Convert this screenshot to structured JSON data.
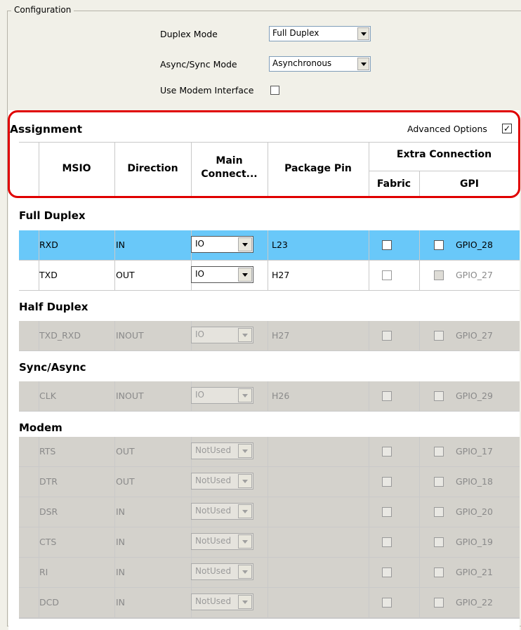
{
  "configuration": {
    "title": "Configuration",
    "duplex_mode": {
      "label": "Duplex Mode",
      "value": "Full Duplex"
    },
    "async_sync_mode": {
      "label": "Async/Sync Mode",
      "value": "Asynchronous"
    },
    "use_modem_interface": {
      "label": "Use Modem Interface",
      "checked": false
    }
  },
  "assignment": {
    "title": "Assignment",
    "advanced_options": {
      "label": "Advanced Options",
      "checked": true,
      "mark": "✓"
    },
    "columns": {
      "msio": "MSIO",
      "direction": "Direction",
      "main_connect_line1": "Main",
      "main_connect_line2": "Connect...",
      "package_pin": "Package Pin",
      "extra_connection": "Extra Connection",
      "fabric": "Fabric",
      "gpi": "GPI"
    },
    "groups": {
      "full_duplex": "Full Duplex",
      "half_duplex": "Half Duplex",
      "sync_async": "Sync/Async",
      "modem": "Modem"
    },
    "rows": [
      {
        "msio": "RXD",
        "direction": "IN",
        "main": "IO",
        "pin": "L23",
        "gpio": "GPIO_28",
        "state": "selected"
      },
      {
        "msio": "TXD",
        "direction": "OUT",
        "main": "IO",
        "pin": "H27",
        "gpio": "GPIO_27",
        "state": "normal"
      },
      {
        "msio": "TXD_RXD",
        "direction": "INOUT",
        "main": "IO",
        "pin": "H27",
        "gpio": "GPIO_27",
        "state": "disabled"
      },
      {
        "msio": "CLK",
        "direction": "INOUT",
        "main": "IO",
        "pin": "H26",
        "gpio": "GPIO_29",
        "state": "disabled"
      },
      {
        "msio": "RTS",
        "direction": "OUT",
        "main": "NotUsed",
        "pin": "",
        "gpio": "GPIO_17",
        "state": "disabled"
      },
      {
        "msio": "DTR",
        "direction": "OUT",
        "main": "NotUsed",
        "pin": "",
        "gpio": "GPIO_18",
        "state": "disabled"
      },
      {
        "msio": "DSR",
        "direction": "IN",
        "main": "NotUsed",
        "pin": "",
        "gpio": "GPIO_20",
        "state": "disabled"
      },
      {
        "msio": "CTS",
        "direction": "IN",
        "main": "NotUsed",
        "pin": "",
        "gpio": "GPIO_19",
        "state": "disabled"
      },
      {
        "msio": "RI",
        "direction": "IN",
        "main": "NotUsed",
        "pin": "",
        "gpio": "GPIO_21",
        "state": "disabled"
      },
      {
        "msio": "DCD",
        "direction": "IN",
        "main": "NotUsed",
        "pin": "",
        "gpio": "GPIO_22",
        "state": "disabled"
      }
    ]
  },
  "colors": {
    "selected_row": "#69c8f9",
    "disabled_row": "#d4d2cc",
    "highlight_border": "#e00000"
  }
}
